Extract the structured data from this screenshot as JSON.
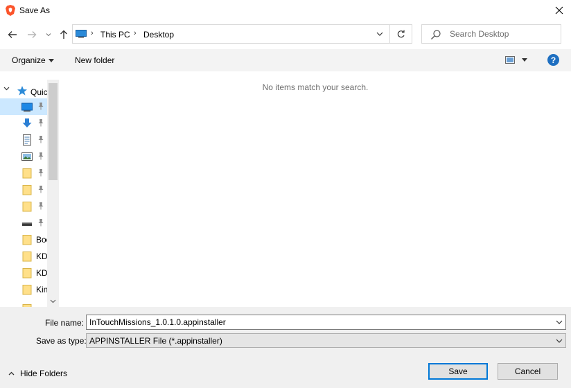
{
  "window": {
    "title": "Save As"
  },
  "address": {
    "crumbs": [
      "This PC",
      "Desktop"
    ]
  },
  "search": {
    "placeholder": "Search Desktop"
  },
  "toolbar": {
    "organize_label": "Organize",
    "new_folder_label": "New folder",
    "help_label": "?"
  },
  "navpane": {
    "quick_access_label": "Quic",
    "items": [
      {
        "icon": "desktop-icon",
        "label": "",
        "pinned": true,
        "selected": true
      },
      {
        "icon": "downloads-icon",
        "label": "",
        "pinned": true
      },
      {
        "icon": "documents-icon",
        "label": "",
        "pinned": true
      },
      {
        "icon": "pictures-icon",
        "label": "",
        "pinned": true
      },
      {
        "icon": "folder-icon",
        "label": "",
        "pinned": true
      },
      {
        "icon": "folder-icon",
        "label": "",
        "pinned": true
      },
      {
        "icon": "folder-icon",
        "label": "",
        "pinned": true
      },
      {
        "icon": "drive-icon",
        "label": "",
        "pinned": true
      },
      {
        "icon": "folder-icon",
        "label": "Boo",
        "pinned": false
      },
      {
        "icon": "folder-icon",
        "label": "KD",
        "pinned": false
      },
      {
        "icon": "folder-icon",
        "label": "KD",
        "pinned": false
      },
      {
        "icon": "folder-icon",
        "label": "Kin",
        "pinned": false
      }
    ]
  },
  "content": {
    "empty_message": "No items match your search."
  },
  "form": {
    "file_name_label": "File name:",
    "file_name_value": "InTouchMissions_1.0.1.0.appinstaller",
    "save_as_type_label": "Save as type:",
    "save_as_type_value": "APPINSTALLER File (*.appinstaller)"
  },
  "footer": {
    "hide_folders_label": "Hide Folders",
    "save_label": "Save",
    "cancel_label": "Cancel"
  },
  "colors": {
    "accent": "#0078d7",
    "selection": "#cce8ff",
    "panel": "#f0f0f0",
    "brave_orange": "#fb542b"
  }
}
